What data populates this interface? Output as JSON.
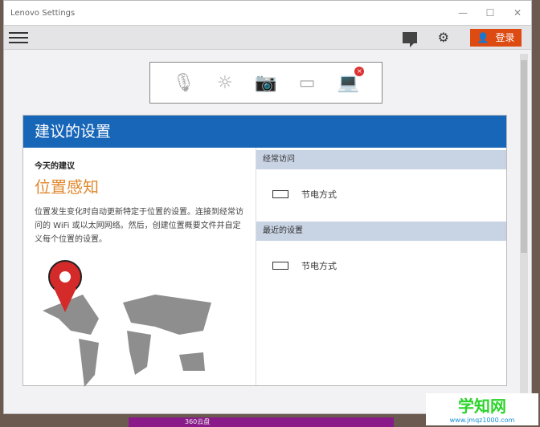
{
  "window": {
    "title": "Lenovo Settings",
    "min": "—",
    "max": "☐",
    "close": "✕"
  },
  "toolbar": {
    "login_label": "登录"
  },
  "icons": [
    "microphone-icon",
    "brightness-icon",
    "camera-icon",
    "display-icon",
    "wifi-laptop-icon"
  ],
  "panel": {
    "title": "建议的设置",
    "subtitle": "今天的建议",
    "feature": "位置感知",
    "description": "位置发生变化时自动更新特定于位置的设置。连接到经常访问的 WiFi 或以太网网络。然后，创建位置概要文件并自定义每个位置的设置。",
    "frequent": {
      "label": "经常访问",
      "item": "节电方式"
    },
    "recent": {
      "label": "最近的设置",
      "item": "节电方式"
    }
  },
  "taskbar": {
    "label": "360云盘"
  },
  "watermark": {
    "name": "学知网",
    "url": "www.jmqz1000.com"
  }
}
